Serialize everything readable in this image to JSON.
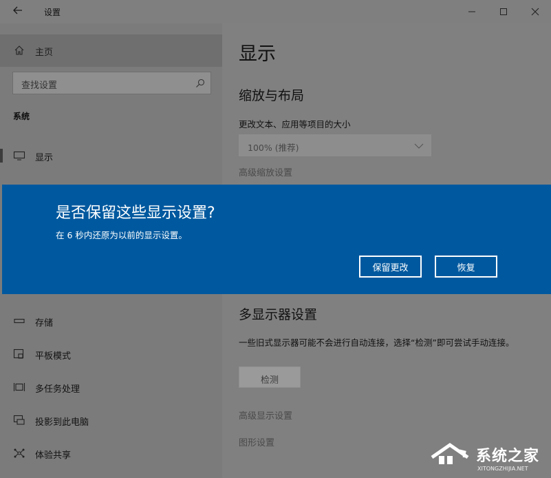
{
  "window": {
    "title": "设置"
  },
  "sidebar": {
    "home_label": "主页",
    "search_placeholder": "查找设置",
    "section_title": "系统",
    "items": [
      {
        "label": "显示",
        "icon": "monitor-icon"
      },
      {
        "label": "存储",
        "icon": "storage-icon"
      },
      {
        "label": "平板模式",
        "icon": "tablet-mode-icon"
      },
      {
        "label": "多任务处理",
        "icon": "multitasking-icon"
      },
      {
        "label": "投影到此电脑",
        "icon": "project-icon"
      },
      {
        "label": "体验共享",
        "icon": "share-icon"
      }
    ]
  },
  "content": {
    "page_title": "显示",
    "scale_heading": "缩放与布局",
    "scale_label": "更改文本、应用等项目的大小",
    "scale_value": "100% (推荐)",
    "advanced_scaling_link": "高级缩放设置",
    "multi_display_heading": "多显示器设置",
    "multi_display_desc": "一些旧式显示器可能不会进行自动连接，选择“检测”即可尝试手动连接。",
    "detect_button": "检测",
    "advanced_display_link": "高级显示设置",
    "graphics_link": "图形设置"
  },
  "dialog": {
    "question": "是否保留这些显示设置?",
    "message": "在  6 秒内还原为以前的显示设置。",
    "keep_button": "保留更改",
    "revert_button": "恢复",
    "background_color": "#00599f"
  },
  "watermark": {
    "text": "系统之家",
    "url_text": "XITONGZHIJIA.NET"
  }
}
